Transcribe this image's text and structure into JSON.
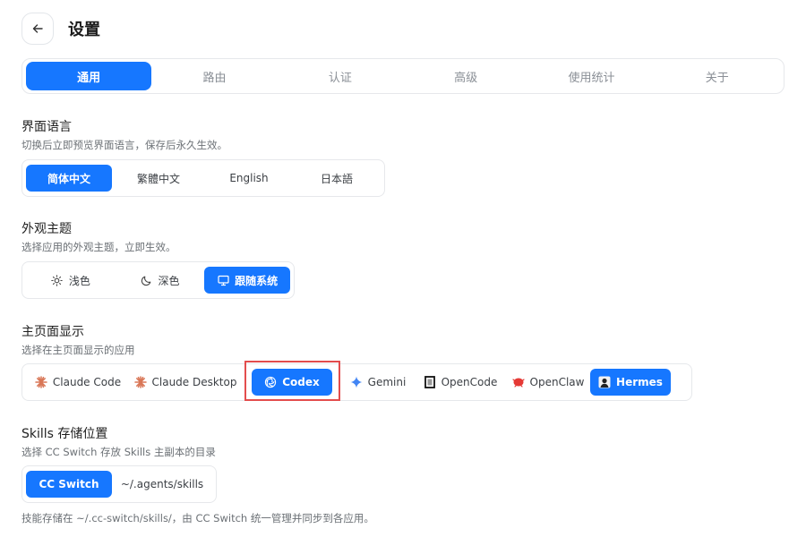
{
  "header": {
    "title": "设置"
  },
  "tabs": [
    {
      "label": "通用",
      "active": true
    },
    {
      "label": "路由",
      "active": false
    },
    {
      "label": "认证",
      "active": false
    },
    {
      "label": "高级",
      "active": false
    },
    {
      "label": "使用统计",
      "active": false
    },
    {
      "label": "关于",
      "active": false
    }
  ],
  "language": {
    "title": "界面语言",
    "desc": "切换后立即预览界面语言，保存后永久生效。",
    "options": [
      "简体中文",
      "繁體中文",
      "English",
      "日本語"
    ],
    "selected": "简体中文"
  },
  "theme": {
    "title": "外观主题",
    "desc": "选择应用的外观主题，立即生效。",
    "options": [
      {
        "label": "浅色",
        "icon": "sun-icon"
      },
      {
        "label": "深色",
        "icon": "moon-icon"
      },
      {
        "label": "跟随系统",
        "icon": "monitor-icon"
      }
    ],
    "selected": "跟随系统"
  },
  "home_display": {
    "title": "主页面显示",
    "desc": "选择在主页面显示的应用",
    "apps": [
      {
        "label": "Claude Code",
        "icon": "claude-icon",
        "active": false
      },
      {
        "label": "Claude Desktop",
        "icon": "claude-icon",
        "active": false
      },
      {
        "label": "Codex",
        "icon": "openai-icon",
        "active": true
      },
      {
        "label": "Gemini",
        "icon": "gemini-icon",
        "active": false
      },
      {
        "label": "OpenCode",
        "icon": "opencode-icon",
        "active": false
      },
      {
        "label": "OpenClaw",
        "icon": "openclaw-icon",
        "active": false
      },
      {
        "label": "Hermes",
        "icon": "hermes-icon",
        "active": true
      }
    ]
  },
  "skills": {
    "title": "Skills 存储位置",
    "desc": "选择 CC Switch 存放 Skills 主副本的目录",
    "options": [
      "CC Switch",
      "~/.agents/skills"
    ],
    "selected": "CC Switch",
    "footnote": "技能存储在 ~/.cc-switch/skills/，由 CC Switch 统一管理并同步到各应用。"
  },
  "colors": {
    "accent": "#1677ff",
    "highlight": "#e34d4d",
    "claude": "#d97757",
    "gemini": "#4285f4",
    "openclaw": "#e53935"
  }
}
